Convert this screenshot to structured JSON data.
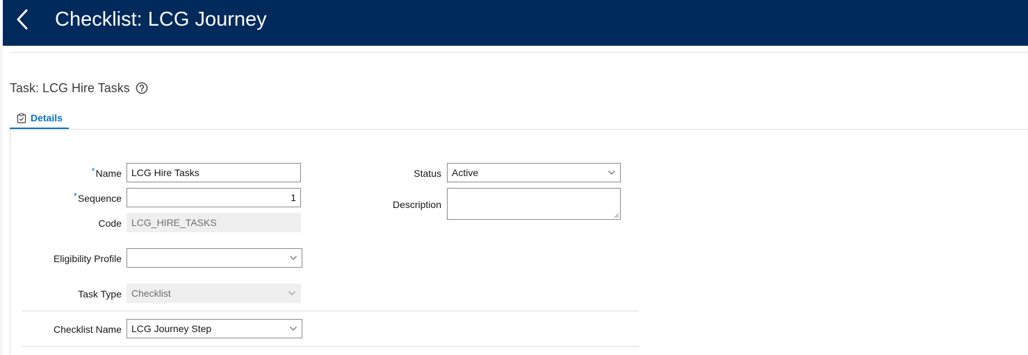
{
  "header": {
    "title": "Checklist: LCG Journey"
  },
  "task": {
    "title": "Task: LCG Hire Tasks"
  },
  "tabs": [
    {
      "label": "Details"
    }
  ],
  "form": {
    "name": {
      "label": "Name",
      "required_mark": "*",
      "value": "LCG Hire Tasks"
    },
    "sequence": {
      "label": "Sequence",
      "required_mark": "*",
      "value": "1"
    },
    "code": {
      "label": "Code",
      "value": "LCG_HIRE_TASKS"
    },
    "eligibility_profile": {
      "label": "Eligibility Profile",
      "value": ""
    },
    "task_type": {
      "label": "Task Type",
      "value": "Checklist"
    },
    "checklist_name": {
      "label": "Checklist Name",
      "value": "LCG Journey Step"
    },
    "status": {
      "label": "Status",
      "value": "Active"
    },
    "description": {
      "label": "Description",
      "value": ""
    }
  },
  "colors": {
    "header_bg": "#002a5c",
    "accent": "#0572ce"
  },
  "icons": {
    "back": "chevron-left-icon",
    "help": "question-circle-icon",
    "tab": "clipboard-check-icon",
    "dropdown": "chevron-down-icon"
  }
}
